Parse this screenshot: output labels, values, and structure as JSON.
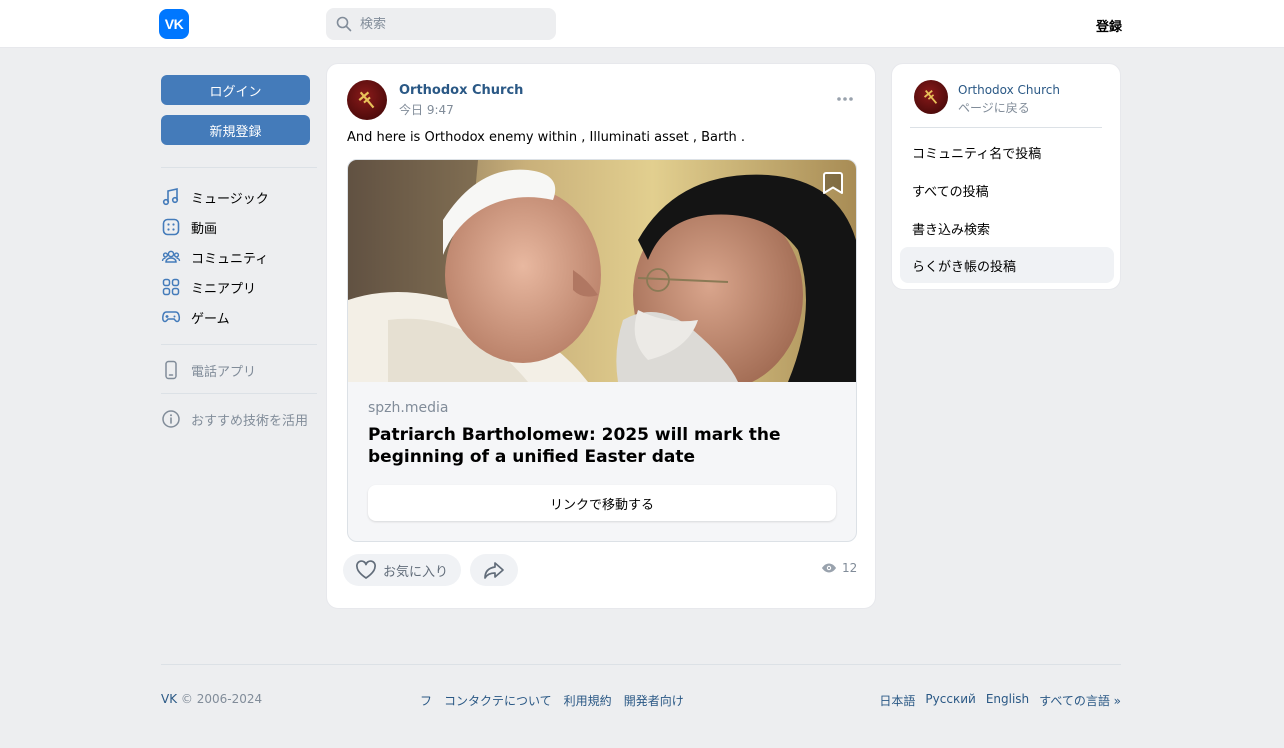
{
  "header": {
    "logo_text": "VK",
    "search_placeholder": "検索",
    "register_label": "登録"
  },
  "sidebar": {
    "login_label": "ログイン",
    "signup_label": "新規登録",
    "nav_items": [
      "ミュージック",
      "動画",
      "コミュニティ",
      "ミニアプリ",
      "ゲーム"
    ],
    "phone_app_label": "電話アプリ",
    "recommend_label": "おすすめ技術を活用"
  },
  "post": {
    "author": "Orthodox Church",
    "time": "今日 9:47",
    "text": "And here is Orthodox enemy within , Illuminati asset , Barth .",
    "link": {
      "domain": "spzh.media",
      "title": "Patriarch Bartholomew: 2025 will mark the beginning of a unified Easter date",
      "button_label": "リンクで移動する"
    },
    "like_label": "お気に入り",
    "views": "12"
  },
  "right_card": {
    "name": "Orthodox Church",
    "back_label": "ページに戻る",
    "items": [
      "コミュニティ名で投稿",
      "すべての投稿",
      "書き込み検索",
      "らくがき帳の投稿"
    ]
  },
  "footer": {
    "copy_brand": "VK",
    "copy_years": "© 2006-2024",
    "links": [
      "フ",
      "コンタクテについて",
      "利用規約",
      "開発者向け"
    ],
    "languages": [
      "日本語",
      "Русский",
      "English",
      "すべての言語 »"
    ]
  },
  "colors": {
    "accent": "#0077ff",
    "button_blue": "#447bba",
    "link": "#2a5885",
    "muted": "#818c99",
    "background": "#edeef0"
  }
}
